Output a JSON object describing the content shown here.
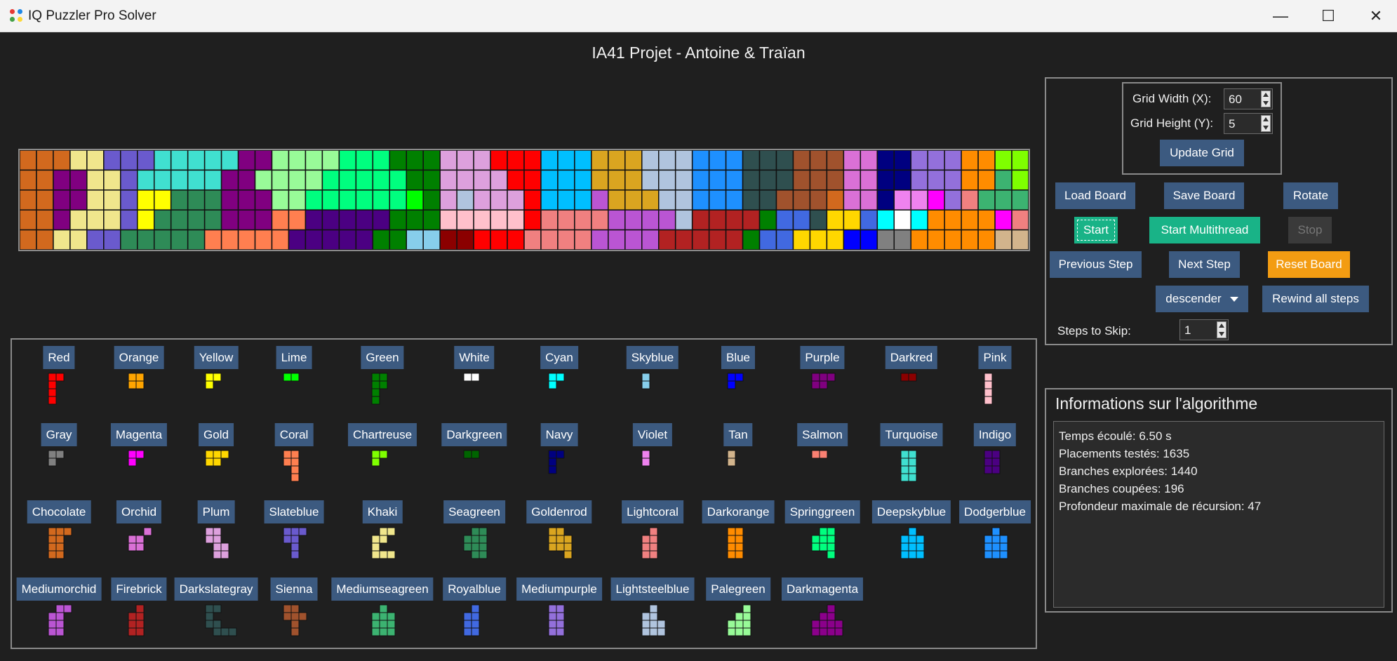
{
  "window": {
    "title": "IQ Puzzler Pro Solver",
    "controls": [
      "—",
      "☐",
      "✕"
    ]
  },
  "heading": "IA41 Projet - Antoine & Traïan",
  "colors": {
    "Red": "#ff0000",
    "Orange": "#ffa500",
    "Yellow": "#ffff00",
    "Lime": "#00ff00",
    "Green": "#008000",
    "White": "#ffffff",
    "Cyan": "#00ffff",
    "Skyblue": "#87ceeb",
    "Blue": "#0000ff",
    "Purple": "#800080",
    "Darkred": "#8b0000",
    "Pink": "#ffc0cb",
    "Gray": "#808080",
    "Magenta": "#ff00ff",
    "Gold": "#ffd700",
    "Coral": "#ff7f50",
    "Chartreuse": "#7fff00",
    "Darkgreen": "#006400",
    "Navy": "#000080",
    "Violet": "#ee82ee",
    "Tan": "#d2b48c",
    "Salmon": "#fa8072",
    "Turquoise": "#40e0d0",
    "Indigo": "#4b0082",
    "Chocolate": "#d2691e",
    "Orchid": "#da70d6",
    "Plum": "#dda0dd",
    "Slateblue": "#6a5acd",
    "Khaki": "#f0e68c",
    "Seagreen": "#2e8b57",
    "Goldenrod": "#daa520",
    "Lightcoral": "#f08080",
    "Darkorange": "#ff8c00",
    "Springgreen": "#00ff7f",
    "Deepskyblue": "#00bfff",
    "Dodgerblue": "#1e90ff",
    "Mediumorchid": "#ba55d3",
    "Firebrick": "#b22222",
    "Darkslategray": "#2f4f4f",
    "Sienna": "#a0522d",
    "Mediumseagreen": "#3cb371",
    "Royalblue": "#4169e1",
    "Mediumpurple": "#9370db",
    "Lightsteelblue": "#b0c4de",
    "Palegreen": "#98fb98",
    "Darkmagenta": "#8b008b"
  },
  "board": {
    "width": 60,
    "height": 5,
    "rows": [
      "Chocolate Chocolate Chocolate Khaki Khaki Slateblue Slateblue Slateblue Turquoise Turquoise Turquoise Turquoise Turquoise Purple Purple Palegreen Palegreen Palegreen Palegreen Springgreen Springgreen Springgreen Green Green Green Plum Plum Plum Red Red Red Deepskyblue Deepskyblue Deepskyblue Goldenrod Goldenrod Goldenrod Lightsteelblue Lightsteelblue Lightsteelblue Dodgerblue Dodgerblue Dodgerblue Darkslategray Darkslategray Darkslategray Sienna Sienna Sienna Orchid Orchid Navy Navy Mediumpurple Mediumpurple Mediumpurple Darkorange Darkorange Chartreuse Chartreuse",
      "Chocolate Chocolate Purple Purple Khaki Khaki Slateblue Turquoise Turquoise Turquoise Turquoise Turquoise Purple Purple Palegreen Palegreen Palegreen Palegreen Springgreen Springgreen Springgreen Springgreen Springgreen Green Green Plum Plum Plum Plum Red Red Deepskyblue Deepskyblue Deepskyblue Goldenrod Goldenrod Goldenrod Lightsteelblue Lightsteelblue Lightsteelblue Dodgerblue Dodgerblue Dodgerblue Darkslategray Darkslategray Darkslategray Sienna Sienna Sienna Orchid Orchid Navy Navy Mediumpurple Mediumpurple Mediumpurple Darkorange Darkorange Mediumseagreen Chartreuse",
      "Chocolate Chocolate Purple Purple Khaki Khaki Slateblue Yellow Yellow Seagreen Seagreen Seagreen Purple Purple Purple Palegreen Palegreen Springgreen Springgreen Springgreen Springgreen Springgreen Springgreen Lime Green Plum Lightsteelblue Plum Plum Plum Red Deepskyblue Deepskyblue Deepskyblue Mediumorchid Goldenrod Goldenrod Goldenrod Lightsteelblue Lightsteelblue Dodgerblue Dodgerblue Dodgerblue Darkslategray Darkslategray Sienna Sienna Sienna Chocolate Orchid Orchid Navy Violet Violet Magenta Mediumpurple Lightcoral Mediumseagreen Mediumseagreen Mediumseagreen",
      "Chocolate Chocolate Purple Khaki Khaki Khaki Slateblue Yellow Seagreen Seagreen Seagreen Seagreen Purple Purple Purple Coral Coral Indigo Indigo Indigo Indigo Indigo Green Green Green Pink Pink Pink Pink Pink Red Lightcoral Lightcoral Lightcoral Lightcoral Mediumorchid Mediumorchid Mediumorchid Mediumorchid Lightsteelblue Firebrick Firebrick Firebrick Firebrick Green Royalblue Royalblue Darkslategray Gold Gold Royalblue Cyan White Cyan Darkorange Darkorange Darkorange Darkorange Magenta Lightcoral Mediumseagreen Mediumseagreen Mediumseagreen",
      "Chocolate Chocolate Khaki Khaki Slateblue Slateblue Seagreen Seagreen Seagreen Seagreen Seagreen Coral Coral Coral Coral Coral Indigo Indigo Indigo Indigo Indigo Green Green Skyblue Skyblue Darkred Darkred Red Red Red Lightcoral Lightcoral Lightcoral Lightcoral Mediumorchid Mediumorchid Mediumorchid Mediumorchid Firebrick Firebrick Firebrick Firebrick Firebrick Green Royalblue Royalblue Gold Gold Gold Blue Blue Gray Gray Darkorange Darkorange Darkorange Darkorange Darkorange Tan Tan Mediumseagreen Mediumseagreen Mediumseagreen"
    ]
  },
  "pieces": [
    {
      "name": "Red",
      "cells": "x x|x|x|x"
    },
    {
      "name": "Orange",
      "cells": "x x|x x"
    },
    {
      "name": "Yellow",
      "cells": "x x|x"
    },
    {
      "name": "Lime",
      "cells": "x x"
    },
    {
      "name": "Green",
      "cells": "x x|x x|x|x"
    },
    {
      "name": "White",
      "cells": "x x"
    },
    {
      "name": "Cyan",
      "cells": "x x|x"
    },
    {
      "name": "Skyblue",
      "cells": "x|x"
    },
    {
      "name": "Blue",
      "cells": "x x|x"
    },
    {
      "name": "Purple",
      "cells": "x x x|x x"
    },
    {
      "name": "Darkred",
      "cells": "x x"
    },
    {
      "name": "Pink",
      "cells": "x|x|x|x"
    },
    {
      "name": "Gray",
      "cells": "x x|x"
    },
    {
      "name": "Magenta",
      "cells": "x x|x"
    },
    {
      "name": "Gold",
      "cells": "x x x|x x"
    },
    {
      "name": "Coral",
      "cells": "x x|x x|. x|. x"
    },
    {
      "name": "Chartreuse",
      "cells": "x x|x"
    },
    {
      "name": "Darkgreen",
      "cells": "x x"
    },
    {
      "name": "Navy",
      "cells": "x x|x|x"
    },
    {
      "name": "Violet",
      "cells": "x|x"
    },
    {
      "name": "Tan",
      "cells": "x|x"
    },
    {
      "name": "Salmon",
      "cells": "x x"
    },
    {
      "name": "Turquoise",
      "cells": "x x|x x|x x|x x"
    },
    {
      "name": "Indigo",
      "cells": "x x|x x|x x"
    },
    {
      "name": "Chocolate",
      "cells": "x x x|x x|x x|x x"
    },
    {
      "name": "Orchid",
      "cells": ". . x|x x|x x"
    },
    {
      "name": "Plum",
      "cells": "x x|x x|. x x|. x x"
    },
    {
      "name": "Slateblue",
      "cells": "x x x|x x|. x|. x"
    },
    {
      "name": "Khaki",
      "cells": ". x x|x x|x|x x x"
    },
    {
      "name": "Seagreen",
      "cells": ". x x|x x x|x x x|. x x"
    },
    {
      "name": "Goldenrod",
      "cells": "x x|x x x|x x x|. . x"
    },
    {
      "name": "Lightcoral",
      "cells": ". x|x x|x x|x x"
    },
    {
      "name": "Darkorange",
      "cells": "x x|x x|x x|x x"
    },
    {
      "name": "Springgreen",
      "cells": ". x x|x x x|x x x|. . x"
    },
    {
      "name": "Deepskyblue",
      "cells": ". x|x x x|x x x|x x x"
    },
    {
      "name": "Dodgerblue",
      "cells": ". x|x x x|x x x|x x x"
    },
    {
      "name": "Mediumorchid",
      "cells": ". x x|x x|x x|x x"
    },
    {
      "name": "Firebrick",
      "cells": ". x|x x|x x|x x"
    },
    {
      "name": "Darkslategray",
      "cells": "x x|x|x x|. x x x"
    },
    {
      "name": "Sienna",
      "cells": "x x|x x x|. x|. x"
    },
    {
      "name": "Mediumseagreen",
      "cells": ". x|x x x|x x x|x x x"
    },
    {
      "name": "Royalblue",
      "cells": ". x|x x|x x|x x"
    },
    {
      "name": "Mediumpurple",
      "cells": "x x|x x|x x|x x"
    },
    {
      "name": "Lightsteelblue",
      "cells": ". x|x x|x x x|x x x"
    },
    {
      "name": "Palegreen",
      "cells": ". . x|. x x|x x x|x x x"
    },
    {
      "name": "Darkmagenta",
      "cells": ". . x|. x x|x x x x|x x x x"
    }
  ],
  "controls": {
    "grid_width_label": "Grid Width (X):",
    "grid_width_value": "60",
    "grid_height_label": "Grid Height (Y):",
    "grid_height_value": "5",
    "update_grid": "Update Grid",
    "load_board": "Load Board",
    "save_board": "Save Board",
    "rotate": "Rotate",
    "start": "Start",
    "start_multithread": "Start Multithread",
    "stop": "Stop",
    "previous_step": "Previous Step",
    "next_step": "Next Step",
    "reset_board": "Reset Board",
    "order_select": "descender",
    "rewind_all": "Rewind all steps",
    "steps_to_skip_label": "Steps to Skip:",
    "steps_to_skip_value": "1"
  },
  "info": {
    "title": "Informations sur l'algorithme",
    "lines": [
      "Temps écoulé: 6.50 s",
      "Placements testés: 1635",
      "Branches explorées: 1440",
      "Branches coupées: 196",
      "Profondeur maximale de récursion: 47"
    ]
  }
}
